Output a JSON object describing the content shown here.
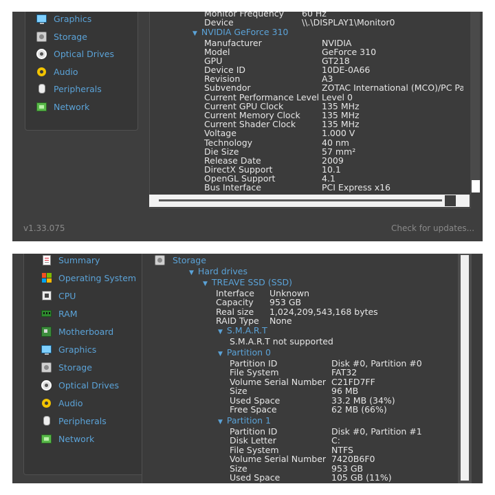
{
  "top": {
    "sidebar": [
      {
        "label": "Graphics",
        "icon": "monitor-icon"
      },
      {
        "label": "Storage",
        "icon": "hard-drive-icon"
      },
      {
        "label": "Optical Drives",
        "icon": "disc-icon"
      },
      {
        "label": "Audio",
        "icon": "speaker-icon"
      },
      {
        "label": "Peripherals",
        "icon": "mouse-icon"
      },
      {
        "label": "Network",
        "icon": "network-icon"
      }
    ],
    "pre_rows": [
      {
        "key": "Monitor Frequency",
        "value": "60 Hz"
      },
      {
        "key": "Device",
        "value": "\\\\.\\DISPLAY1\\Monitor0"
      }
    ],
    "section": "NVIDIA GeForce 310",
    "rows": [
      {
        "key": "Manufacturer",
        "value": "NVIDIA"
      },
      {
        "key": "Model",
        "value": "GeForce 310"
      },
      {
        "key": "GPU",
        "value": "GT218"
      },
      {
        "key": "Device ID",
        "value": "10DE-0A66"
      },
      {
        "key": "Revision",
        "value": "A3"
      },
      {
        "key": "Subvendor",
        "value": "ZOTAC International (MCO)/PC Pa"
      },
      {
        "key": "Current Performance Level",
        "value": "Level 0"
      },
      {
        "key": "Current GPU Clock",
        "value": "135 MHz"
      },
      {
        "key": "Current Memory Clock",
        "value": "135 MHz"
      },
      {
        "key": "Current Shader Clock",
        "value": "135 MHz"
      },
      {
        "key": "Voltage",
        "value": "1.000 V"
      },
      {
        "key": "Technology",
        "value": "40 nm"
      },
      {
        "key": "Die Size",
        "value": "57 mm²"
      },
      {
        "key": "Release Date",
        "value": "2009"
      },
      {
        "key": "DirectX Support",
        "value": "10.1"
      },
      {
        "key": "OpenGL Support",
        "value": "4.1"
      },
      {
        "key": "Bus Interface",
        "value": "PCI Express x16"
      }
    ],
    "version": "v1.33.075",
    "check_updates": "Check for updates..."
  },
  "bottom": {
    "sidebar": [
      {
        "label": "Summary",
        "icon": "summary-icon"
      },
      {
        "label": "Operating System",
        "icon": "windows-icon"
      },
      {
        "label": "CPU",
        "icon": "cpu-icon"
      },
      {
        "label": "RAM",
        "icon": "ram-icon"
      },
      {
        "label": "Motherboard",
        "icon": "motherboard-icon"
      },
      {
        "label": "Graphics",
        "icon": "monitor-icon"
      },
      {
        "label": "Storage",
        "icon": "hard-drive-icon"
      },
      {
        "label": "Optical Drives",
        "icon": "disc-icon"
      },
      {
        "label": "Audio",
        "icon": "speaker-icon"
      },
      {
        "label": "Peripherals",
        "icon": "mouse-icon"
      },
      {
        "label": "Network",
        "icon": "network-icon"
      }
    ],
    "title": "Storage",
    "hard_drives": "Hard drives",
    "drive": "TREAVE SSD (SSD)",
    "drive_rows": [
      {
        "key": "Interface",
        "value": "Unknown"
      },
      {
        "key": "Capacity",
        "value": "953 GB"
      },
      {
        "key": "Real size",
        "value": "1,024,209,543,168 bytes"
      },
      {
        "key": "RAID Type",
        "value": "None"
      }
    ],
    "smart": "S.M.A.R.T",
    "smart_text": "S.M.A.R.T not supported",
    "partition0": "Partition 0",
    "p0_rows": [
      {
        "key": "Partition ID",
        "value": "Disk #0, Partition #0"
      },
      {
        "key": "File System",
        "value": "FAT32"
      },
      {
        "key": "Volume Serial Number",
        "value": "C21FD7FF"
      },
      {
        "key": "Size",
        "value": "96 MB"
      },
      {
        "key": "Used Space",
        "value": "33.2 MB (34%)"
      },
      {
        "key": "Free Space",
        "value": "62 MB (66%)"
      }
    ],
    "partition1": "Partition 1",
    "p1_rows": [
      {
        "key": "Partition ID",
        "value": "Disk #0, Partition #1"
      },
      {
        "key": "Disk Letter",
        "value": "C:"
      },
      {
        "key": "File System",
        "value": "NTFS"
      },
      {
        "key": "Volume Serial Number",
        "value": "7420B6F0"
      },
      {
        "key": "Size",
        "value": "953 GB"
      },
      {
        "key": "Used Space",
        "value": "105 GB (11%)"
      }
    ]
  }
}
